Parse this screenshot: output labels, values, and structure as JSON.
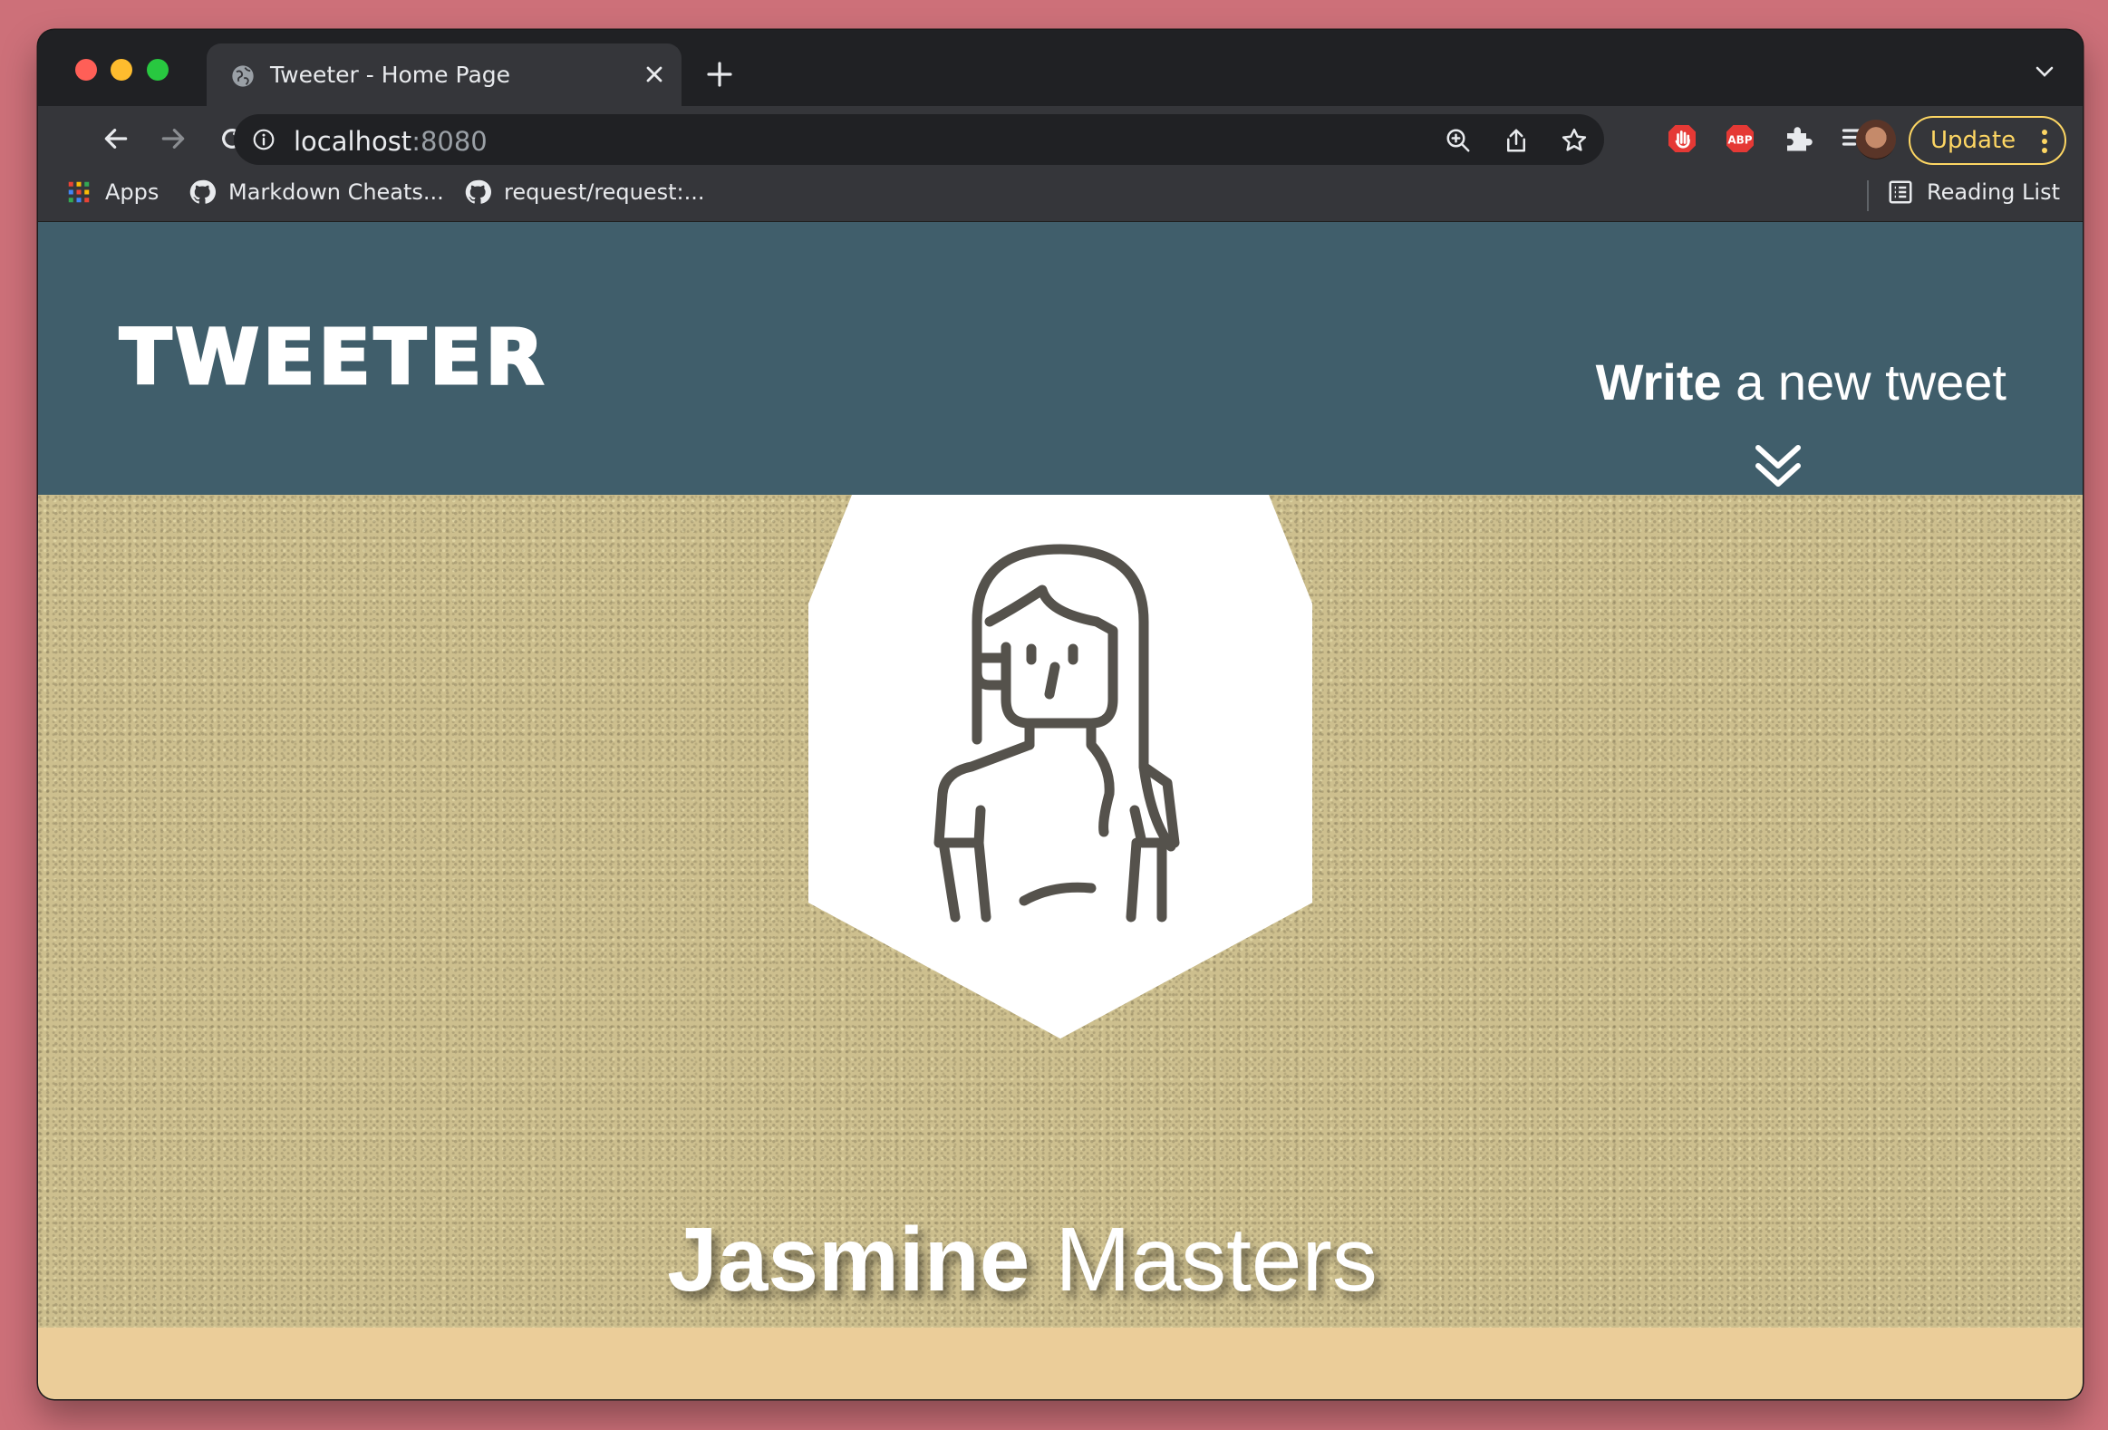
{
  "browser": {
    "tab_title": "Tweeter - Home Page",
    "url_host": "localhost",
    "url_port": ":8080",
    "update_label": "Update",
    "bookmarks": [
      {
        "label": "Apps",
        "icon": "apps-grid-icon"
      },
      {
        "label": "Markdown Cheats...",
        "icon": "github-icon"
      },
      {
        "label": "request/request:...",
        "icon": "github-icon"
      }
    ],
    "reading_list_label": "Reading List"
  },
  "nav": {
    "logo": "TWEETER",
    "compose_bold": "Write",
    "compose_rest": " a new tweet"
  },
  "profile": {
    "first_name": "Jasmine",
    "last_name": " Masters",
    "avatar_icon": "woman-avatar-icon"
  },
  "colors": {
    "navbar": "#405e6b",
    "header_texture": "#cdbf8e",
    "page_bg": "#ebcd99",
    "desktop": "#cd7079"
  }
}
